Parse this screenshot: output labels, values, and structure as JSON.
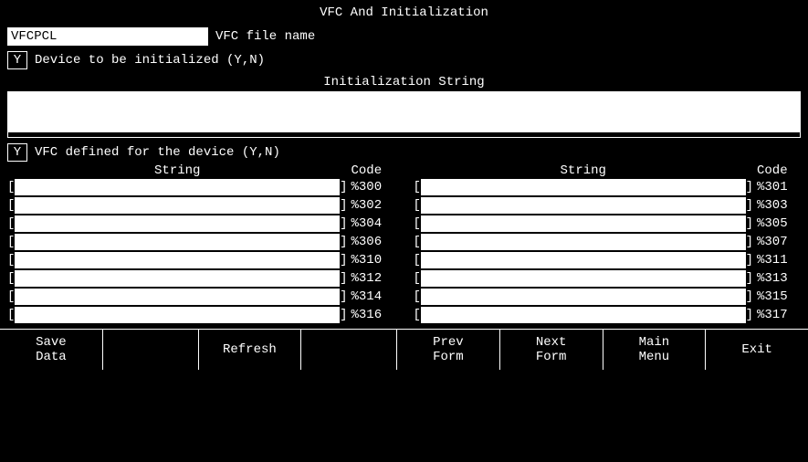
{
  "title": "VFC And Initialization",
  "vfc_filename": {
    "value": "VFCPCL",
    "label": "VFC file name"
  },
  "device_init": {
    "checked": "Y",
    "label": "Device to be initialized (Y,N)"
  },
  "init_string": {
    "section_title": "Initialization String",
    "line1": "",
    "line2": ""
  },
  "vfc_defined": {
    "checked": "Y",
    "label": "VFC defined for the device (Y,N)"
  },
  "strings_table": {
    "left": {
      "header_string": "String",
      "header_code": "Code",
      "rows": [
        {
          "string": "",
          "code": "%300"
        },
        {
          "string": "",
          "code": "%302"
        },
        {
          "string": "",
          "code": "%304"
        },
        {
          "string": "",
          "code": "%306"
        },
        {
          "string": "",
          "code": "%310"
        },
        {
          "string": "",
          "code": "%312"
        },
        {
          "string": "",
          "code": "%314"
        },
        {
          "string": "",
          "code": "%316"
        }
      ]
    },
    "right": {
      "header_string": "String",
      "header_code": "Code",
      "rows": [
        {
          "string": "",
          "code": "%301"
        },
        {
          "string": "",
          "code": "%303"
        },
        {
          "string": "",
          "code": "%305"
        },
        {
          "string": "",
          "code": "%307"
        },
        {
          "string": "",
          "code": "%311"
        },
        {
          "string": "",
          "code": "%313"
        },
        {
          "string": "",
          "code": "%315"
        },
        {
          "string": "",
          "code": "%317"
        }
      ]
    }
  },
  "footer": {
    "btn1_line1": "Save",
    "btn1_line2": "Data",
    "btn2_line1": "",
    "btn2_line2": "",
    "btn3_line1": "Refresh",
    "btn3_line2": "",
    "btn4_line1": "",
    "btn4_line2": "",
    "btn5_line1": "Prev",
    "btn5_line2": "Form",
    "btn6_line1": "Next",
    "btn6_line2": "Form",
    "btn7_line1": "Main",
    "btn7_line2": "Menu",
    "btn8_line1": "Exit",
    "btn8_line2": ""
  }
}
